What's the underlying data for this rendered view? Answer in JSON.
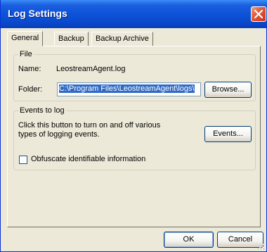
{
  "window": {
    "title": "Log Settings"
  },
  "tabs": [
    {
      "label": "General",
      "active": true
    },
    {
      "label": "Backup",
      "active": false
    },
    {
      "label": "Backup Archive",
      "active": false
    }
  ],
  "file_group": {
    "label": "File",
    "name_label": "Name:",
    "name_value": "LeostreamAgent.log",
    "folder_label": "Folder:",
    "folder_value": "C:\\Program Files\\LeostreamAgent\\logs\\",
    "browse_label": "Browse..."
  },
  "events_group": {
    "label": "Events to log",
    "description": "Click this button to turn on and off various types of logging events.",
    "events_label": "Events...",
    "obfuscate_label": "Obfuscate identifiable information",
    "obfuscate_checked": false
  },
  "footer": {
    "ok_label": "OK",
    "cancel_label": "Cancel"
  },
  "colors": {
    "titlebar": "#0c53d9",
    "close": "#e35b3a",
    "face": "#ece9d8",
    "selection": "#316ac5"
  }
}
